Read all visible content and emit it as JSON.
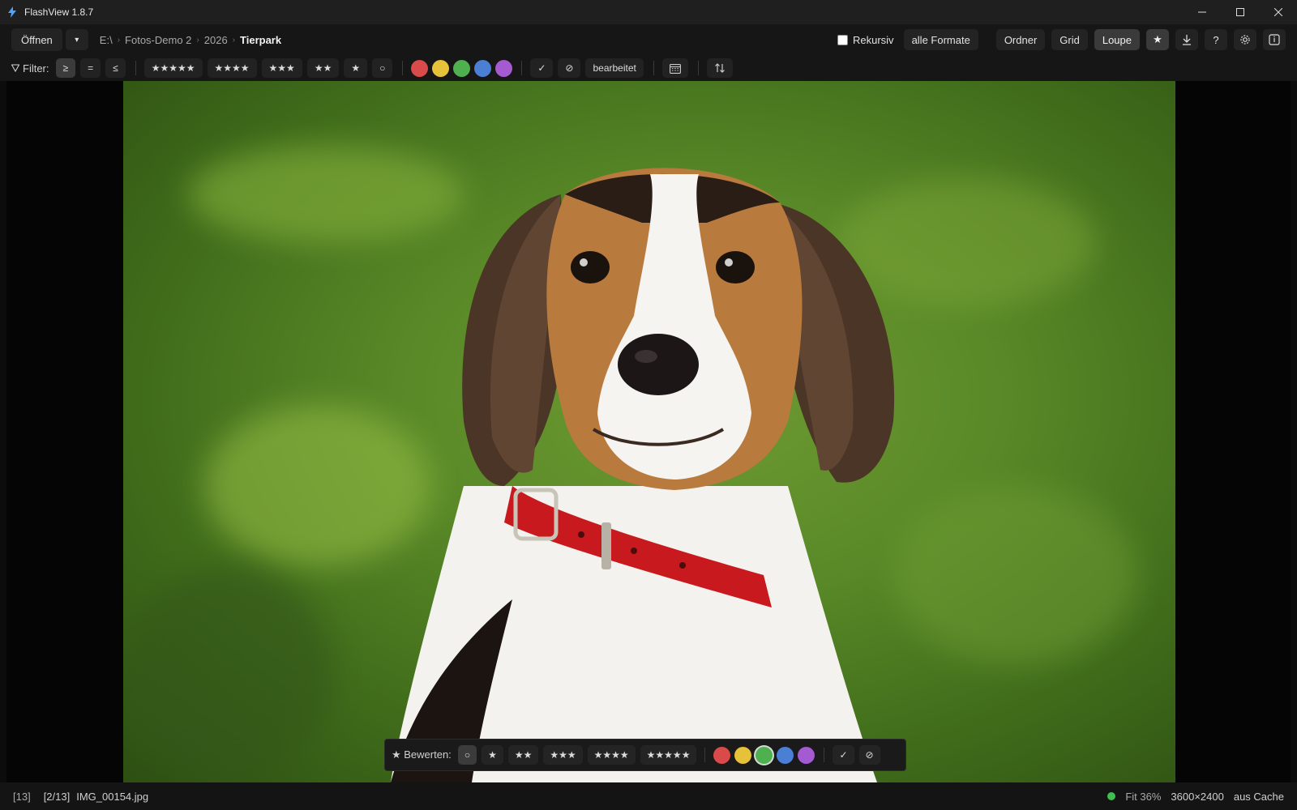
{
  "app": {
    "title": "FlashView 1.8.7"
  },
  "toolbar": {
    "open_label": "Öffnen",
    "open_dropdown": "▾",
    "breadcrumb": [
      "E:\\",
      "Fotos-Demo 2",
      "2026",
      "Tierpark"
    ],
    "recursive_label": "Rekursiv",
    "recursive_checked": false,
    "formats_label": "alle Formate",
    "view_modes": [
      "Ordner",
      "Grid",
      "Loupe"
    ],
    "active_view": "Loupe",
    "star_button": "★",
    "download_icon": "download-icon",
    "help_label": "?",
    "settings_icon": "gear-icon",
    "info_icon": "info-panel-icon"
  },
  "filter": {
    "label": "Filter:",
    "operators": [
      "≥",
      "=",
      "≤"
    ],
    "selected_operator": "≥",
    "stars": [
      "★★★★★",
      "★★★★",
      "★★★",
      "★★",
      "★",
      "○"
    ],
    "colors": [
      "#d94a4a",
      "#e6c13a",
      "#4fb04f",
      "#4a7fd4",
      "#a45ad0"
    ],
    "check": "✓",
    "reject": "⊘",
    "edited_label": "bearbeitet",
    "calendar_icon": "calendar-icon",
    "sort_icon": "sort-icon"
  },
  "photo": {
    "subject": "beagle portrait"
  },
  "rating_bar": {
    "label": "★ Bewerten:",
    "options": [
      "○",
      "★",
      "★★",
      "★★★",
      "★★★★",
      "★★★★★"
    ],
    "selected_option": "○",
    "colors": [
      "#d94a4a",
      "#e6c13a",
      "#4fb04f",
      "#4a7fd4",
      "#a45ad0"
    ],
    "selected_color": "#4fb04f",
    "check": "✓",
    "reject": "⊘"
  },
  "status": {
    "count": "[13]",
    "position": "[2/13]",
    "filename": "IMG_00154.jpg",
    "indicator_color": "#3fbf4f",
    "zoom": "Fit 36%",
    "dimensions": "3600×2400",
    "source": "aus Cache"
  }
}
